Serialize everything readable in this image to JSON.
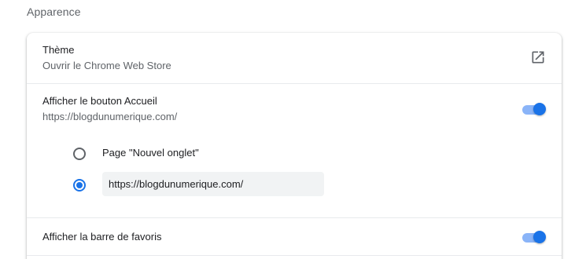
{
  "section": {
    "title": "Apparence"
  },
  "theme": {
    "label": "Thème",
    "sublabel": "Ouvrir le Chrome Web Store",
    "icon": "launch-icon"
  },
  "home_button": {
    "label": "Afficher le bouton Accueil",
    "sublabel": "https://blogdunumerique.com/",
    "enabled": true,
    "options": [
      {
        "label": "Page \"Nouvel onglet\"",
        "selected": false
      },
      {
        "label": "",
        "selected": true
      }
    ],
    "custom_url_value": "https://blogdunumerique.com/"
  },
  "bookmarks_bar": {
    "label": "Afficher la barre de favoris",
    "enabled": true
  },
  "colors": {
    "accent": "#1a73e8",
    "accent_light": "#8ab4f8",
    "secondary_text": "#5f6368",
    "input_bg": "#f1f3f4"
  }
}
